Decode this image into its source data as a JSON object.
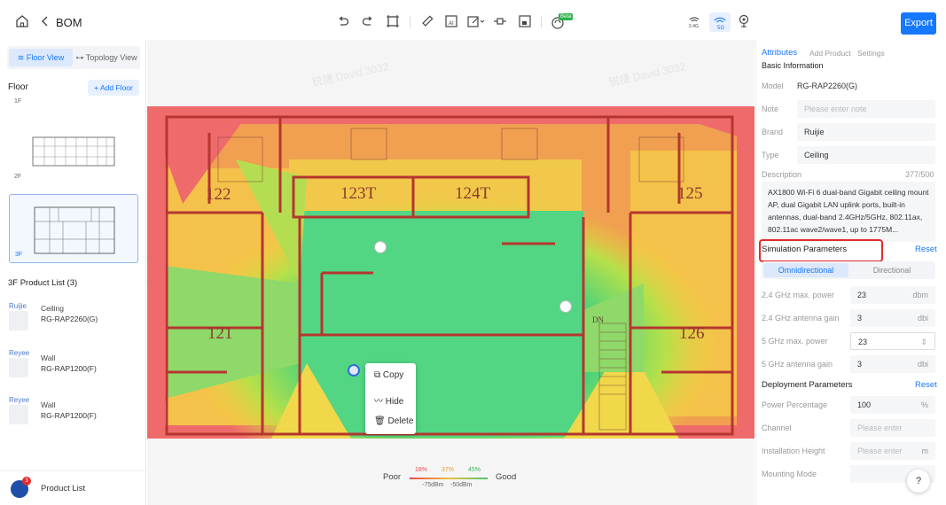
{
  "topbar": {
    "title": "BOM",
    "export_label": "Export",
    "beta_badge": "Beta",
    "icons": [
      "home-icon",
      "back-icon",
      "undo-icon",
      "redo-icon",
      "crop-icon",
      "ruler-icon",
      "ai-wall-icon",
      "draw-wall-icon",
      "door-icon",
      "obstacle-icon",
      "ap-beta-icon",
      "band-2g-icon",
      "band-5g-icon",
      "location-icon"
    ],
    "band_2g": "2.4G",
    "band_5g": "5G"
  },
  "left": {
    "tabs": [
      "Floor View",
      "Topology View"
    ],
    "floor_label": "Floor",
    "add_floor": "+ Add Floor",
    "floors": [
      "1F",
      "2F",
      "3F"
    ],
    "product_list_title": "3F Product List (3)",
    "products": [
      {
        "brand": "Ruijie",
        "type": "Ceiling",
        "model": "RG-RAP2260(G)"
      },
      {
        "brand": "Reyee",
        "type": "Wall",
        "model": "RG-RAP1200(F)"
      },
      {
        "brand": "Reyee",
        "type": "Wall",
        "model": "RG-RAP1200(F)"
      }
    ],
    "product_list_btn": "Product List",
    "product_count": "3"
  },
  "canvas": {
    "rooms": [
      "122",
      "123T",
      "124T",
      "125",
      "121",
      "126",
      "DN"
    ],
    "context_menu": [
      "Copy",
      "Hide",
      "Delete"
    ],
    "legend": {
      "poor": "Poor",
      "good": "Good",
      "pct": [
        "18%",
        "37%",
        "45%"
      ],
      "dbm": [
        "-75dBm",
        "-50dBm"
      ]
    },
    "watermark": "锐捷 David 3032"
  },
  "right": {
    "tabs": [
      "Attributes",
      "Add Product",
      "Settings"
    ],
    "basic_info": "Basic Information",
    "model_label": "Model",
    "model_value": "RG-RAP2260(G)",
    "note_label": "Note",
    "note_placeholder": "Please enter note",
    "brand_label": "Brand",
    "brand_value": "Ruijie",
    "type_label": "Type",
    "type_value": "Ceiling",
    "desc_label": "Description",
    "desc_count": "377/500",
    "description": "AX1800 Wi-Fi 6 dual-band Gigabit ceiling mount AP, dual Gigabit LAN uplink ports, built-in antennas, dual-band 2.4GHz/5GHz, 802.11ax, 802.11ac wave2/wave1, up to 1775M...",
    "sim_title": "Simulation Parameters",
    "reset": "Reset",
    "sim_tabs": [
      "Omnidirectional",
      "Directional"
    ],
    "sim_fields": [
      {
        "label": "2.4 GHz max. power",
        "value": "23",
        "unit": "dbm"
      },
      {
        "label": "2.4 GHz antenna gain",
        "value": "3",
        "unit": "dbi"
      },
      {
        "label": "5 GHz max. power",
        "value": "23",
        "unit": ""
      },
      {
        "label": "5 GHz antenna gain",
        "value": "3",
        "unit": "dbi"
      }
    ],
    "deploy_title": "Deployment Parameters",
    "deploy_fields": [
      {
        "label": "Power Percentage",
        "value": "100",
        "unit": "%"
      },
      {
        "label": "Channel",
        "value": "",
        "placeholder": "Please enter",
        "unit": ""
      },
      {
        "label": "Installation Height",
        "value": "",
        "placeholder": "Please enter",
        "unit": "m"
      },
      {
        "label": "Mounting Mode",
        "value": "",
        "placeholder": "",
        "unit": ""
      }
    ],
    "help": "?"
  }
}
